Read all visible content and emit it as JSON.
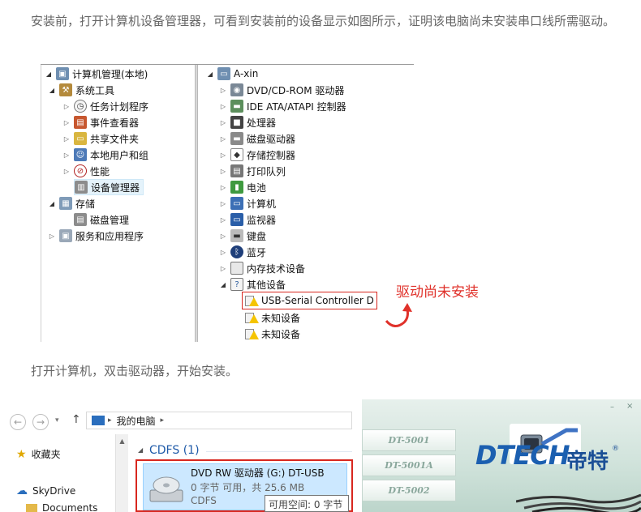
{
  "intro_text": "安装前，打开计算机设备管理器，可看到安装前的设备显示如图所示，证明该电脑尚未安装串口线所需驱动。",
  "step_text": "打开计算机，双击驱动器，开始安装。",
  "computer_management": {
    "left_tree": [
      {
        "label": "计算机管理(本地)",
        "icon": "computer-management-icon"
      },
      {
        "label": "系统工具",
        "icon": "system-tools-icon"
      },
      {
        "label": "任务计划程序",
        "icon": "clock-icon"
      },
      {
        "label": "事件查看器",
        "icon": "event-viewer-icon"
      },
      {
        "label": "共享文件夹",
        "icon": "shared-folder-icon"
      },
      {
        "label": "本地用户和组",
        "icon": "users-icon"
      },
      {
        "label": "性能",
        "icon": "performance-icon"
      },
      {
        "label": "设备管理器",
        "icon": "device-manager-icon"
      },
      {
        "label": "存储",
        "icon": "storage-icon"
      },
      {
        "label": "磁盘管理",
        "icon": "disk-management-icon"
      },
      {
        "label": "服务和应用程序",
        "icon": "services-icon"
      }
    ],
    "right_tree": [
      {
        "label": "A-xin",
        "icon": "computer-icon"
      },
      {
        "label": "DVD/CD-ROM 驱动器",
        "icon": "dvd-icon"
      },
      {
        "label": "IDE ATA/ATAPI 控制器",
        "icon": "ide-icon"
      },
      {
        "label": "处理器",
        "icon": "processor-icon"
      },
      {
        "label": "磁盘驱动器",
        "icon": "disk-drive-icon"
      },
      {
        "label": "存储控制器",
        "icon": "storage-controller-icon"
      },
      {
        "label": "打印队列",
        "icon": "printer-icon"
      },
      {
        "label": "电池",
        "icon": "battery-icon"
      },
      {
        "label": "计算机",
        "icon": "computer-icon"
      },
      {
        "label": "监视器",
        "icon": "monitor-icon"
      },
      {
        "label": "键盘",
        "icon": "keyboard-icon"
      },
      {
        "label": "蓝牙",
        "icon": "bluetooth-icon"
      },
      {
        "label": "内存技术设备",
        "icon": "memory-icon"
      },
      {
        "label": "其他设备",
        "icon": "other-devices-icon"
      },
      {
        "label": "USB-Serial Controller D",
        "icon": "warning-device-icon"
      },
      {
        "label": "未知设备",
        "icon": "warning-device-icon"
      },
      {
        "label": "未知设备",
        "icon": "warning-device-icon"
      }
    ],
    "annotation": "驱动尚未安装",
    "annotation_color": "#e0312a"
  },
  "explorer": {
    "breadcrumb_separator": "▸",
    "location": "我的电脑",
    "nav": [
      {
        "label": "收藏夹",
        "icon": "star-icon"
      },
      {
        "label": "SkyDrive",
        "icon": "cloud-icon"
      },
      {
        "label": "Documents",
        "icon": "folder-icon"
      }
    ],
    "group_header": "CDFS (1)",
    "drive": {
      "title": "DVD RW 驱动器 (G:) DT-USB",
      "usage": "0 字节 可用，共 25.6 MB",
      "fs": "CDFS"
    },
    "tooltip": "可用空间: 0 字节"
  },
  "installer": {
    "tabs": [
      "DT-5001",
      "DT-5001A",
      "DT-5002"
    ],
    "logo_text": "DTECH",
    "logo_cn": "帝特",
    "trademark": "®",
    "brand_color": "#1b5fb0"
  }
}
